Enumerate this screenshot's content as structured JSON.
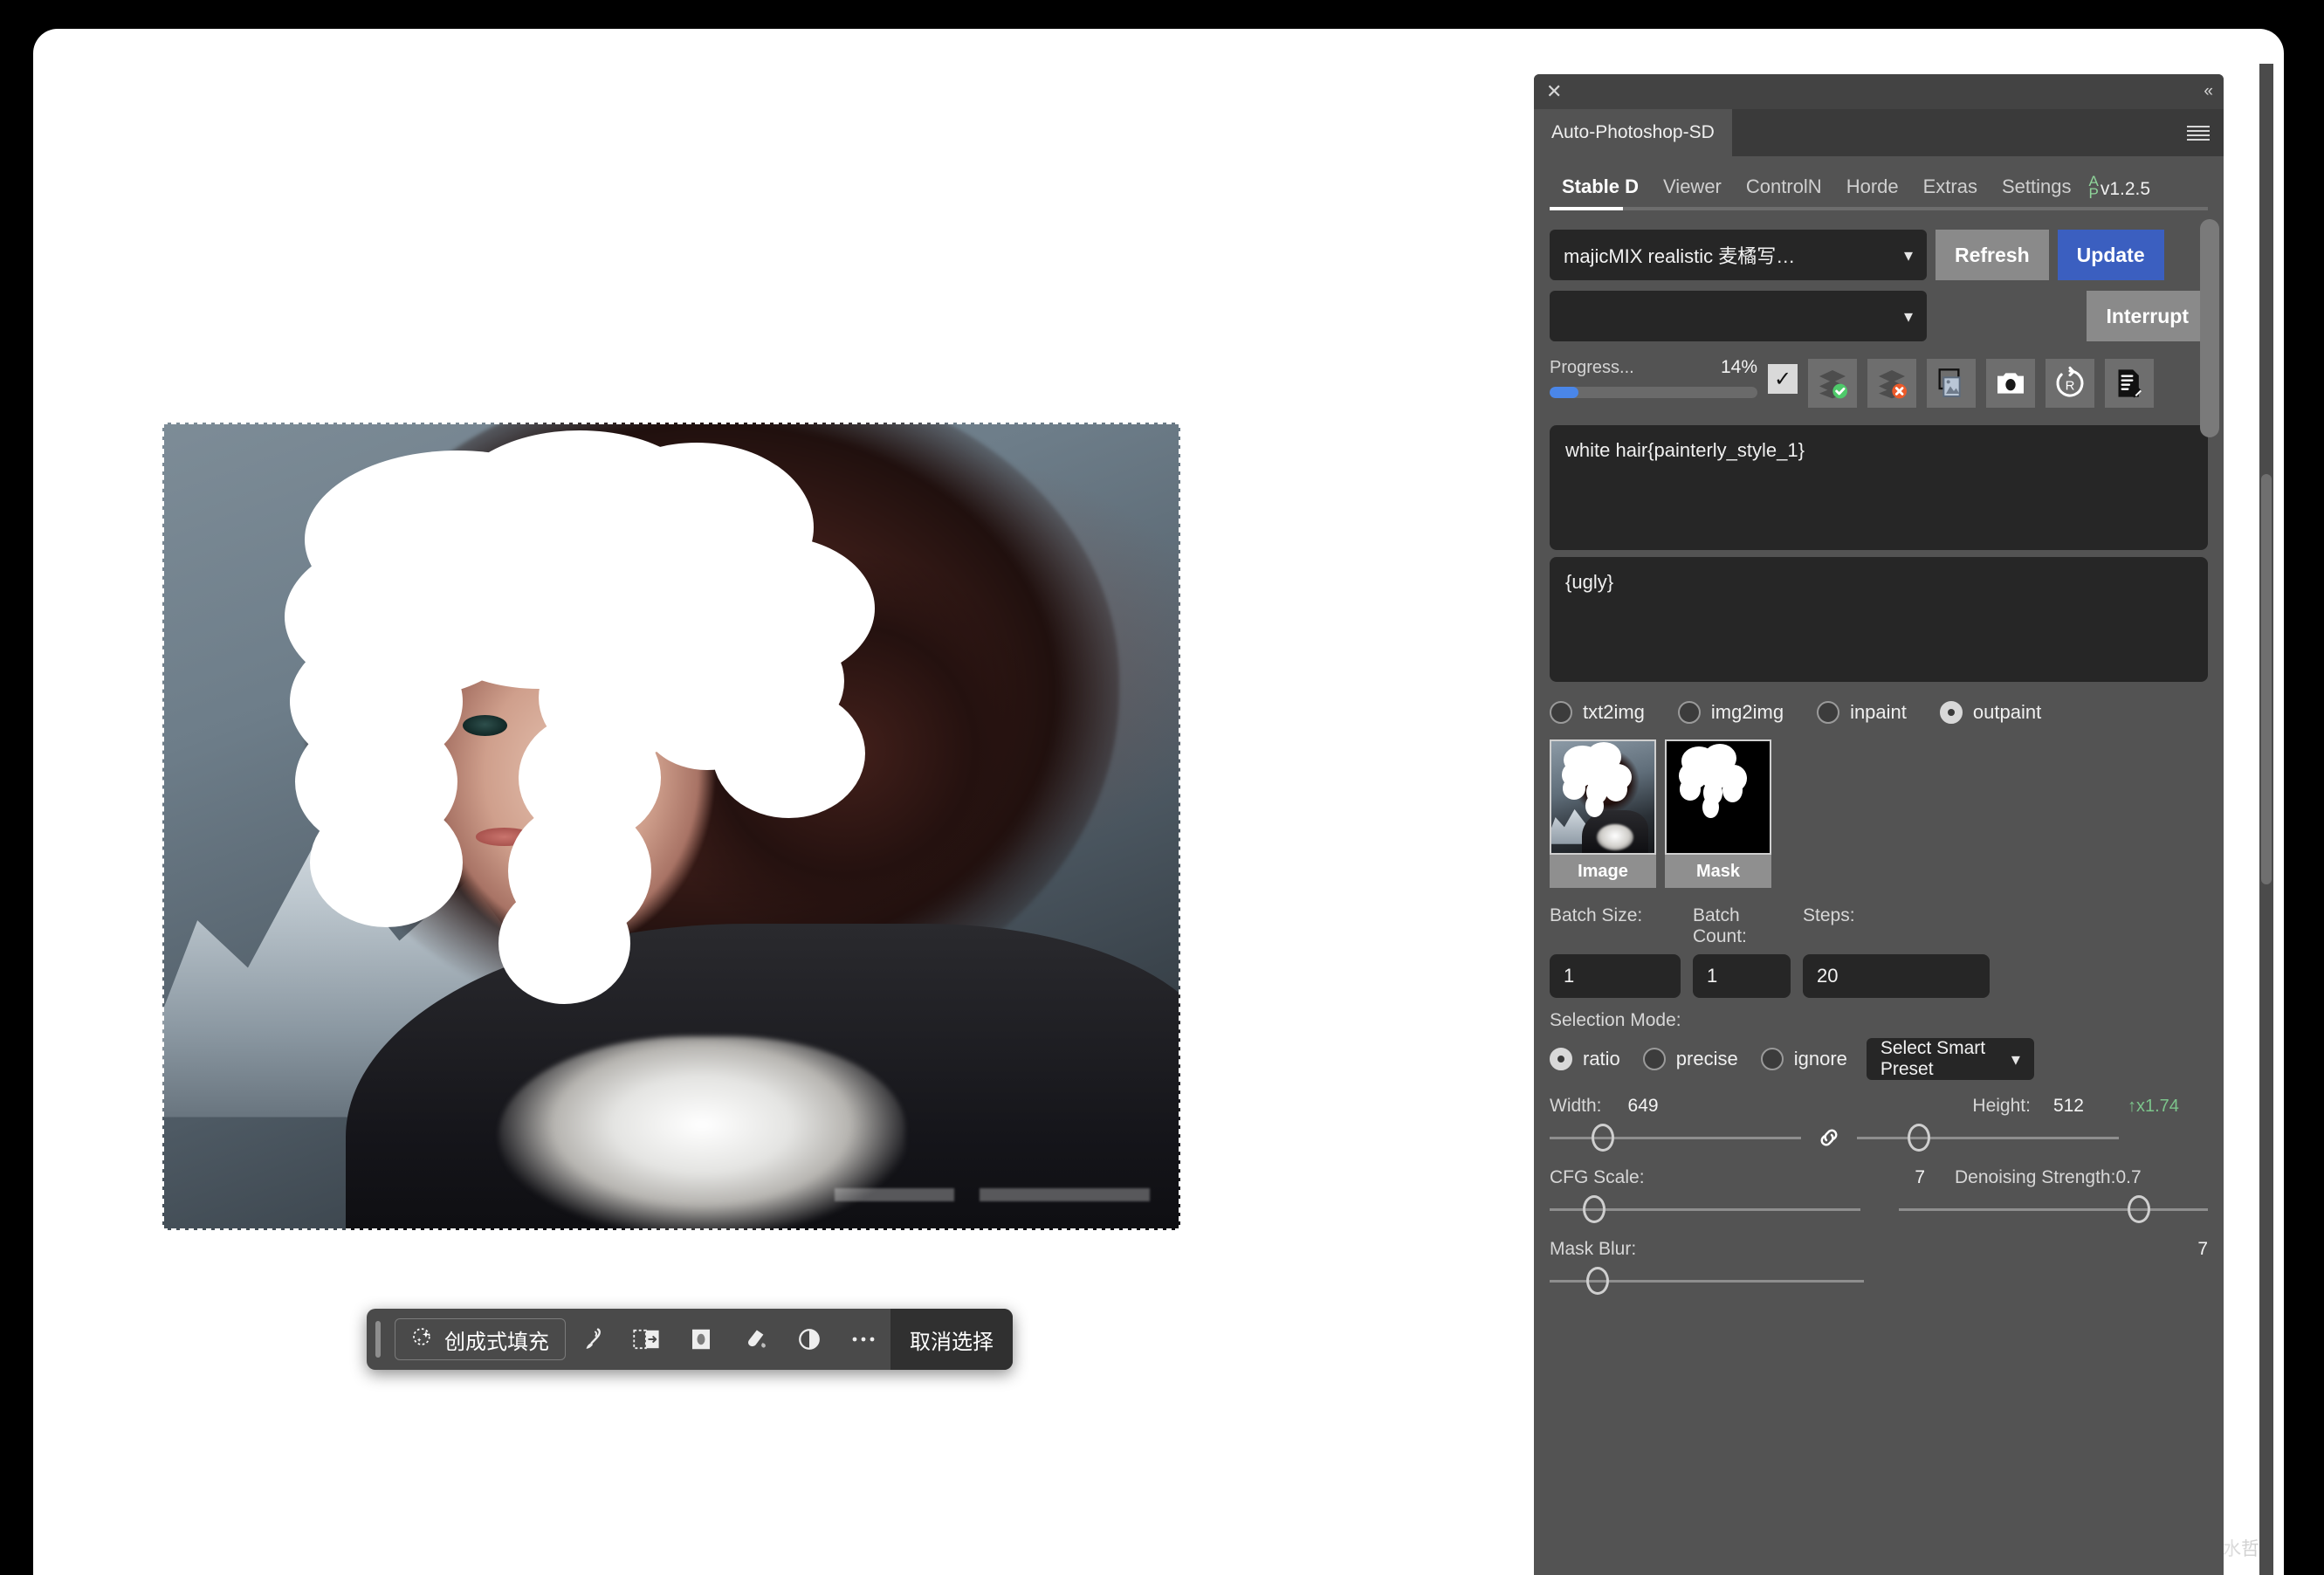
{
  "panel": {
    "close_icon": "close-icon",
    "collapse_icon": "collapse-icon",
    "doc_tab": "Auto-Photoshop-SD",
    "menu_icon": "hamburger-icon",
    "tabs": [
      {
        "label": "Stable D",
        "active": true
      },
      {
        "label": "Viewer",
        "active": false
      },
      {
        "label": "ControlN",
        "active": false
      },
      {
        "label": "Horde",
        "active": false
      },
      {
        "label": "Extras",
        "active": false
      },
      {
        "label": "Settings",
        "active": false
      }
    ],
    "version_prefix_a": "A",
    "version_prefix_p": "P",
    "version": "v1.2.5",
    "model": {
      "value": "majicMIX realistic 麦橘写…",
      "refresh_label": "Refresh",
      "update_label": "Update"
    },
    "vae": {
      "value": "",
      "interrupt_label": "Interrupt"
    },
    "progress": {
      "label": "Progress...",
      "percent_label": "14%",
      "percent_value": 14,
      "checkbox_checked": true,
      "bar_color": "#4a86e8"
    },
    "toolbar_icons": [
      "layers-check-icon",
      "layers-cancel-icon",
      "image-frame-icon",
      "camera-icon",
      "rotate-r-icon",
      "edit-document-icon"
    ],
    "positive_prompt": "white hair{painterly_style_1}",
    "negative_prompt": "{ugly}",
    "modes": [
      {
        "label": "txt2img",
        "selected": false
      },
      {
        "label": "img2img",
        "selected": false
      },
      {
        "label": "inpaint",
        "selected": false
      },
      {
        "label": "outpaint",
        "selected": true
      }
    ],
    "thumbs": [
      {
        "caption": "Image",
        "kind": "source"
      },
      {
        "caption": "Mask",
        "kind": "mask"
      }
    ],
    "fields": {
      "batch_size_label": "Batch Size:",
      "batch_size_value": "1",
      "batch_count_label": "Batch Count:",
      "batch_count_value": "1",
      "steps_label": "Steps:",
      "steps_value": "20"
    },
    "selection_mode": {
      "label": "Selection Mode:",
      "options": [
        {
          "label": "ratio",
          "selected": true
        },
        {
          "label": "precise",
          "selected": false
        },
        {
          "label": "ignore",
          "selected": false
        }
      ],
      "preset_value": "Select Smart Preset"
    },
    "size": {
      "width_label": "Width:",
      "width_value": "649",
      "height_label": "Height:",
      "height_value": "512",
      "scale_badge": "↑x1.74",
      "link_icon": "link-icon"
    },
    "cfg": {
      "label": "CFG Scale:",
      "value": "7",
      "denoise_label": "Denoising Strength:0.7"
    },
    "mask_blur": {
      "label": "Mask Blur:",
      "value": "7"
    }
  },
  "photoshop": {
    "task_bar": {
      "generative_fill_label": "创成式填充",
      "generative_fill_icon": "sparkle-selection-icon",
      "icons": [
        "brush-icon",
        "transform-selection-icon",
        "mask-icon",
        "fill-icon",
        "adjustment-icon",
        "more-options-icon"
      ],
      "deselect_label": "取消选择",
      "drag_handle": "drag-handle"
    }
  },
  "watermark": "CSDN @易水哲"
}
